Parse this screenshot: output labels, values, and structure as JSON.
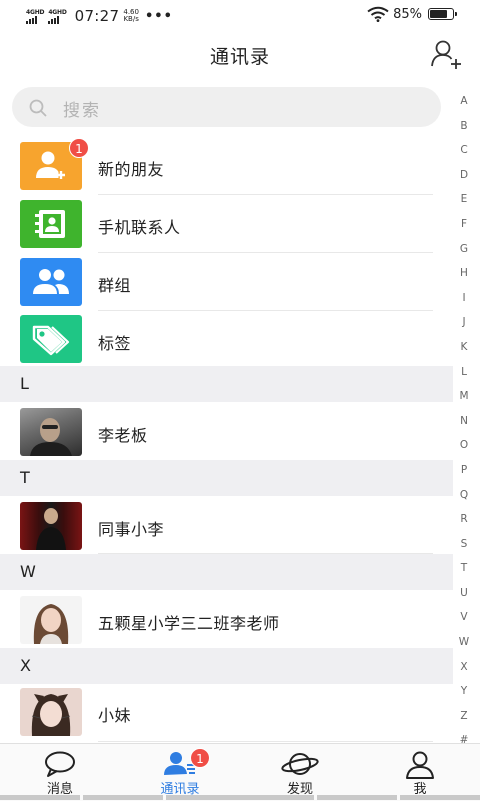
{
  "status_bar": {
    "signal_1_tag": "4GHD",
    "signal_2_tag": "4GHD",
    "time": "07:27",
    "net_speed_value": "4.60",
    "net_speed_unit": "KB/s",
    "more_dots": "•••",
    "battery_text": "85%",
    "battery_level": 0.85,
    "icons": [
      "signal-icon",
      "signal-icon",
      "wifi-icon",
      "battery-icon"
    ]
  },
  "header": {
    "title": "通讯录",
    "add_icon": "add-contact-icon"
  },
  "search": {
    "placeholder": "搜索",
    "icon": "search-icon"
  },
  "functions": [
    {
      "label": "新的朋友",
      "icon": "new-friend-icon",
      "color": "#f7a42e",
      "badge": "1"
    },
    {
      "label": "手机联系人",
      "icon": "phone-contacts-icon",
      "color": "#3fb42d"
    },
    {
      "label": "群组",
      "icon": "group-icon",
      "color": "#2f8bf2"
    },
    {
      "label": "标签",
      "icon": "tag-icon",
      "color": "#1fc685"
    }
  ],
  "sections": [
    {
      "letter": "L",
      "contacts": [
        {
          "name": "李老板",
          "avatar": "avatar-photo"
        }
      ]
    },
    {
      "letter": "T",
      "contacts": [
        {
          "name": "同事小李",
          "avatar": "avatar-photo"
        }
      ]
    },
    {
      "letter": "W",
      "contacts": [
        {
          "name": "五颗星小学三二班李老师",
          "avatar": "avatar-photo"
        }
      ]
    },
    {
      "letter": "X",
      "contacts": [
        {
          "name": "小妹",
          "avatar": "avatar-photo"
        }
      ]
    }
  ],
  "index_bar": [
    "A",
    "B",
    "C",
    "D",
    "E",
    "F",
    "G",
    "H",
    "I",
    "J",
    "K",
    "L",
    "M",
    "N",
    "O",
    "P",
    "Q",
    "R",
    "S",
    "T",
    "U",
    "V",
    "W",
    "X",
    "Y",
    "Z",
    "#"
  ],
  "tabs": [
    {
      "label": "消息",
      "icon": "message-icon",
      "active": false
    },
    {
      "label": "通讯录",
      "icon": "contacts-icon",
      "active": true,
      "badge": "1"
    },
    {
      "label": "发现",
      "icon": "planet-icon",
      "active": false
    },
    {
      "label": "我",
      "icon": "profile-icon",
      "active": false
    }
  ],
  "colors": {
    "accent": "#2f7de1",
    "badge": "#f04e46",
    "section_bg": "#efeff2"
  }
}
